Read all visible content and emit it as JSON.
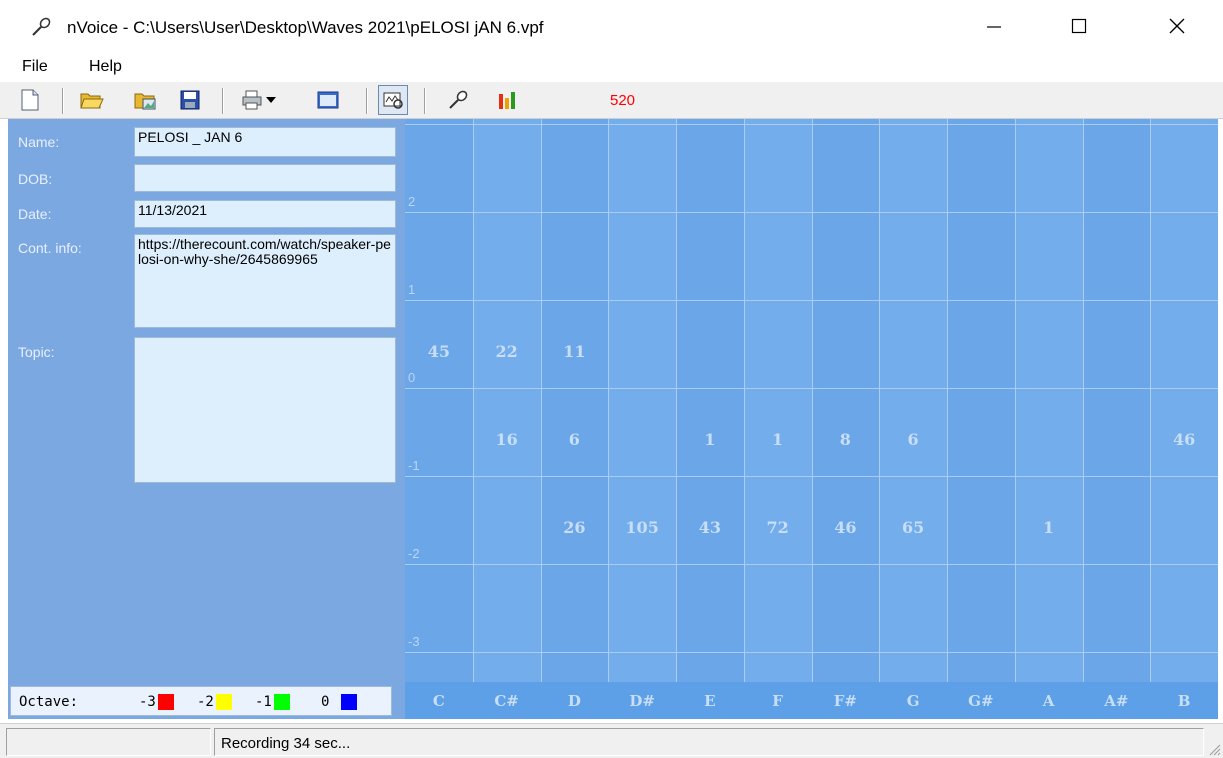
{
  "window": {
    "title": "nVoice - C:\\Users\\User\\Desktop\\Waves 2021\\pELOSI jAN 6.vpf",
    "app_icon": "microphone-icon",
    "buttons": [
      "minimize-icon",
      "maximize-icon",
      "close-icon"
    ]
  },
  "menu": {
    "file": "File",
    "help": "Help"
  },
  "toolbar": {
    "icons": [
      "new-document-icon",
      "open-folder-icon",
      "open-image-icon",
      "save-icon",
      "print-icon",
      "dropdown-arrow-icon",
      "view-window-icon",
      "analyze-icon",
      "microphone-icon",
      "bar-chart-icon"
    ],
    "counter": "520",
    "counter_color": "#ff0000"
  },
  "form": {
    "name_label": "Name:",
    "name_value": "PELOSI _ JAN 6",
    "dob_label": "DOB:",
    "dob_value": "",
    "date_label": "Date:",
    "date_value": "11/13/2021",
    "contact_label": "Cont. info:",
    "contact_value": "https://therecount.com/watch/speaker-pelosi-on-why-she/2645869965",
    "topic_label": "Topic:",
    "topic_value": ""
  },
  "octave_legend": {
    "label": "Octave:",
    "items": [
      {
        "label": "-3",
        "color": "#ff0000"
      },
      {
        "label": "-2",
        "color": "#ffff00"
      },
      {
        "label": "-1",
        "color": "#00ff00"
      },
      {
        "label": "0",
        "color": "#0000ff"
      }
    ]
  },
  "chart_data": {
    "type": "heatmap",
    "columns": [
      "C",
      "C#",
      "D",
      "D#",
      "E",
      "F",
      "F#",
      "G",
      "G#",
      "A",
      "A#",
      "B"
    ],
    "row_labels": [
      "2",
      "1",
      "0",
      "-1",
      "-2",
      "-3"
    ],
    "rows": [
      {
        "octave": "0",
        "values": [
          "45",
          "22",
          "11",
          "",
          "",
          "",
          "",
          "",
          "",
          "",
          "",
          ""
        ]
      },
      {
        "octave": "-1",
        "values": [
          "",
          "16",
          "6",
          "",
          "1",
          "1",
          "8",
          "6",
          "",
          "",
          "",
          "46"
        ]
      },
      {
        "octave": "-2",
        "values": [
          "",
          "",
          "26",
          "105",
          "43",
          "72",
          "46",
          "65",
          "",
          "1",
          "",
          ""
        ]
      }
    ]
  },
  "status": {
    "text": "Recording 34 sec..."
  }
}
